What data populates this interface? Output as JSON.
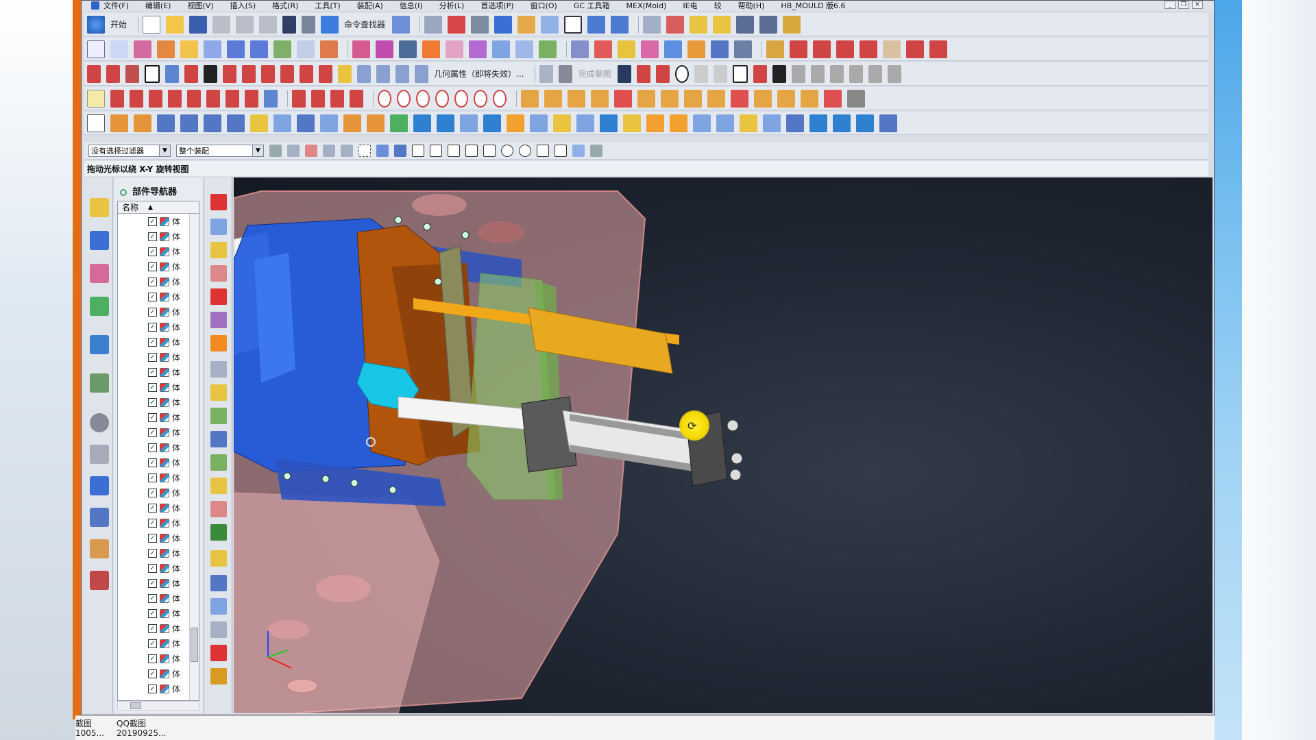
{
  "app": {
    "menus": [
      "文件(F)",
      "编辑(E)",
      "视图(V)",
      "插入(S)",
      "格式(R)",
      "工具(T)",
      "装配(A)",
      "信息(I)",
      "分析(L)",
      "首选项(P)",
      "窗口(O)",
      "GC 工具箱",
      "MEX(Mold)",
      "IE电",
      "较",
      "帮助(H)",
      "HB_MOULD 版6.6"
    ],
    "window_controls": [
      "_",
      "❐",
      "✕"
    ]
  },
  "toolbar1": {
    "start_label": "开始",
    "cmd_finder_label": "命令查找器"
  },
  "toolbar3": {
    "geom_prop_label": "几何属性（即将失效）...",
    "finish_sketch_label": "完成草图"
  },
  "selection_bar": {
    "filter_value": "没有选择过滤器",
    "scope_value": "整个装配"
  },
  "status": {
    "message": "拖动光标以绕 X-Y 旋转视图"
  },
  "navigator": {
    "title": "部件导航器",
    "column_name": "名称",
    "rows": [
      "体",
      "体",
      "体",
      "体",
      "体",
      "体",
      "体",
      "体",
      "体",
      "体",
      "体",
      "体",
      "体",
      "体",
      "体",
      "体",
      "体",
      "体",
      "体",
      "体",
      "体",
      "体",
      "体",
      "体",
      "体",
      "体",
      "体",
      "体",
      "体",
      "体",
      "体",
      "体"
    ]
  },
  "taskbar": {
    "items": [
      {
        "line1": "截图",
        "line2": "1005..."
      },
      {
        "line1": "QQ截图",
        "line2": "20190925..."
      }
    ]
  },
  "colors": {
    "viewport_bg": "#1d2430",
    "toolbar_bg": "#e4e8ef",
    "accent_blue": "#2e63c7"
  }
}
